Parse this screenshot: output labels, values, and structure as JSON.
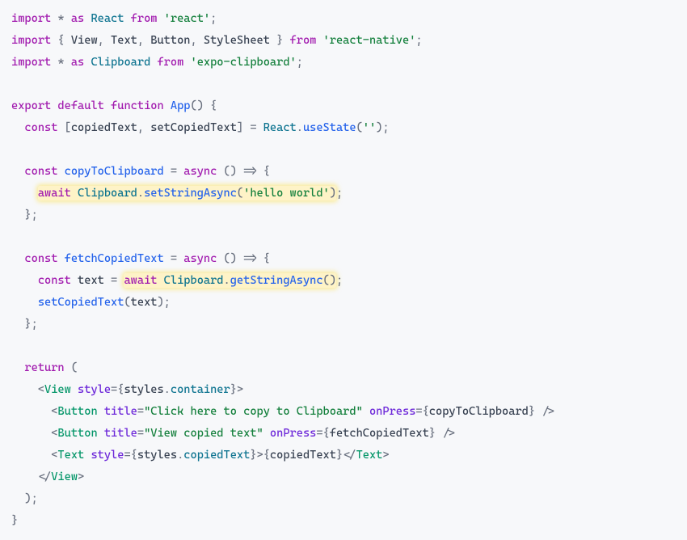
{
  "code": {
    "l1_import": "import",
    "l1_star": "*",
    "l1_as": "as",
    "l1_react": "React",
    "l1_from": "from",
    "l1_mod": "'react'",
    "semi": ";",
    "l2_import": "import",
    "l2_view": "View",
    "l2_text": "Text",
    "l2_button": "Button",
    "l2_stylesheet": "StyleSheet",
    "l2_from": "from",
    "l2_mod": "'react-native'",
    "l3_import": "import",
    "l3_star": "*",
    "l3_as": "as",
    "l3_clipboard": "Clipboard",
    "l3_from": "from",
    "l3_mod": "'expo-clipboard'",
    "l5_export": "export",
    "l5_default": "default",
    "l5_function": "function",
    "l5_app": "App",
    "l6_const": "const",
    "l6_copiedText": "copiedText",
    "l6_setCopiedText": "setCopiedText",
    "l6_react": "React",
    "l6_useState": "useState",
    "l6_arg": "''",
    "l8_const": "const",
    "l8_name": "copyToClipboard",
    "l8_async": "async",
    "l9_await": "await",
    "l9_clipboard": "Clipboard",
    "l9_method": "setStringAsync",
    "l9_arg": "'hello world'",
    "l12_const": "const",
    "l12_name": "fetchCopiedText",
    "l12_async": "async",
    "l13_const": "const",
    "l13_text": "text",
    "l13_await": "await",
    "l13_clipboard": "Clipboard",
    "l13_method": "getStringAsync",
    "l14_fn": "setCopiedText",
    "l14_arg": "text",
    "l17_return": "return",
    "l18_view": "View",
    "l18_style": "style",
    "l18_styles": "styles",
    "l18_container": "container",
    "l19_button": "Button",
    "l19_title": "title",
    "l19_titleval": "\"Click here to copy to Clipboard\"",
    "l19_onpress": "onPress",
    "l19_handler": "copyToClipboard",
    "l20_button": "Button",
    "l20_title": "title",
    "l20_titleval": "\"View copied text\"",
    "l20_onpress": "onPress",
    "l20_handler": "fetchCopiedText",
    "l21_text": "Text",
    "l21_style": "style",
    "l21_styles": "styles",
    "l21_copiedText": "copiedText",
    "l21_var": "copiedText",
    "l22_view": "View"
  }
}
